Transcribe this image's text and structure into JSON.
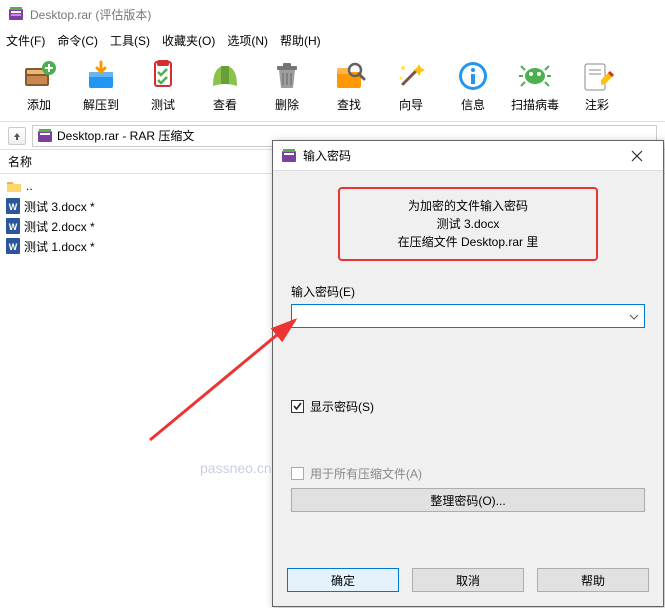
{
  "window": {
    "title": "Desktop.rar (评估版本)"
  },
  "menu": {
    "file": "文件(F)",
    "command": "命令(C)",
    "tools": "工具(S)",
    "favorites": "收藏夹(O)",
    "options": "选项(N)",
    "help": "帮助(H)"
  },
  "toolbar": {
    "add": "添加",
    "extract": "解压到",
    "test": "测试",
    "view": "查看",
    "delete": "删除",
    "find": "查找",
    "wizard": "向导",
    "info": "信息",
    "scan": "扫描病毒",
    "comment": "注彩"
  },
  "path": {
    "text": "Desktop.rar - RAR 压缩文"
  },
  "list": {
    "header_name": "名称",
    "parent": "..",
    "items": [
      {
        "name": "测试 3.docx *"
      },
      {
        "name": "测试 2.docx *"
      },
      {
        "name": "测试 1.docx *"
      }
    ]
  },
  "dialog": {
    "title": "输入密码",
    "info1": "为加密的文件输入密码",
    "info2": "测试 3.docx",
    "info3": "在压缩文件 Desktop.rar 里",
    "field_label": "输入密码(E)",
    "show_pw": "显示密码(S)",
    "all_archives": "用于所有压缩文件(A)",
    "organize": "整理密码(O)...",
    "ok": "确定",
    "cancel": "取消",
    "help": "帮助",
    "input_value": ""
  },
  "watermark": "passneo.cn"
}
